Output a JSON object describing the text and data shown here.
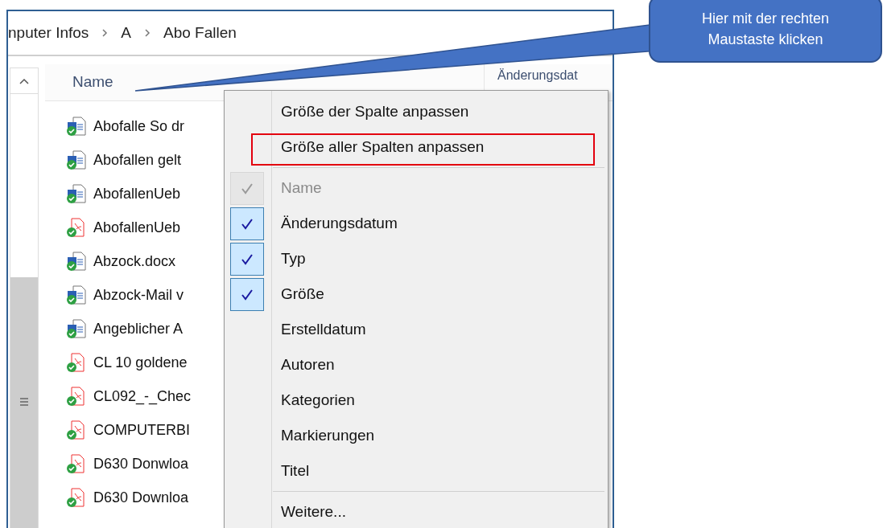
{
  "breadcrumb": [
    "nputer Infos",
    "A",
    "Abo Fallen"
  ],
  "columns": [
    {
      "label": "Name"
    },
    {
      "label": "Änderungsdat"
    }
  ],
  "files": [
    {
      "name": "Abofalle So dr",
      "kind": "word"
    },
    {
      "name": "Abofallen gelt",
      "kind": "word"
    },
    {
      "name": "AbofallenUeb",
      "kind": "word"
    },
    {
      "name": "AbofallenUeb",
      "kind": "pdf"
    },
    {
      "name": "Abzock.docx",
      "kind": "word"
    },
    {
      "name": "Abzock-Mail v",
      "kind": "word"
    },
    {
      "name": "Angeblicher A",
      "kind": "word"
    },
    {
      "name": "CL 10 goldene",
      "kind": "pdf"
    },
    {
      "name": "CL092_-_Chec",
      "kind": "pdf"
    },
    {
      "name": "COMPUTERBI",
      "kind": "pdf"
    },
    {
      "name": "D630 Donwloa",
      "kind": "pdf"
    },
    {
      "name": "D630 Downloa",
      "kind": "pdf"
    }
  ],
  "context_menu": [
    {
      "kind": "action",
      "label": "Größe der Spalte anpassen",
      "highlighted": false
    },
    {
      "kind": "action",
      "label": "Größe aller Spalten anpassen",
      "highlighted": true
    },
    {
      "kind": "separator"
    },
    {
      "kind": "column",
      "label": "Name",
      "checked": true,
      "disabled": true
    },
    {
      "kind": "column",
      "label": "Änderungsdatum",
      "checked": true,
      "disabled": false
    },
    {
      "kind": "column",
      "label": "Typ",
      "checked": true,
      "disabled": false
    },
    {
      "kind": "column",
      "label": "Größe",
      "checked": true,
      "disabled": false
    },
    {
      "kind": "column",
      "label": "Erstelldatum",
      "checked": false,
      "disabled": false
    },
    {
      "kind": "column",
      "label": "Autoren",
      "checked": false,
      "disabled": false
    },
    {
      "kind": "column",
      "label": "Kategorien",
      "checked": false,
      "disabled": false
    },
    {
      "kind": "column",
      "label": "Markierungen",
      "checked": false,
      "disabled": false
    },
    {
      "kind": "column",
      "label": "Titel",
      "checked": false,
      "disabled": false
    },
    {
      "kind": "separator"
    },
    {
      "kind": "action",
      "label": "Weitere...",
      "highlighted": false
    }
  ],
  "callout": {
    "lines": [
      "Hier mit der rechten",
      "Maustaste klicken"
    ]
  }
}
